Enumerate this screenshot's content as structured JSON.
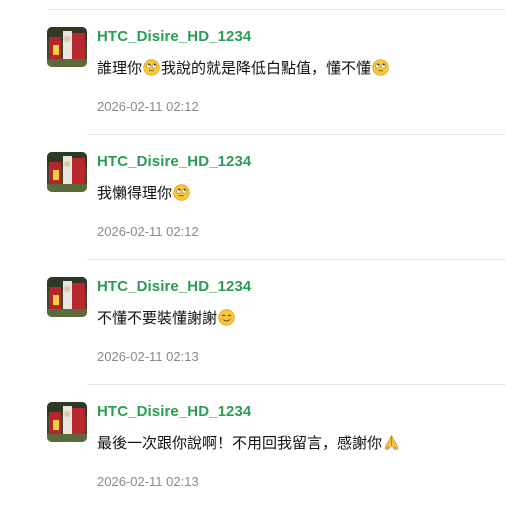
{
  "comments": [
    {
      "username": "HTC_Disire_HD_1234",
      "message_parts": [
        "誰理你",
        "我說的就是降低白點值，懂不懂"
      ],
      "emojis": [
        "rolling-eyes-emoji",
        "rolling-eyes-emoji"
      ],
      "timestamp": "2026-02-11 02:12"
    },
    {
      "username": "HTC_Disire_HD_1234",
      "message_parts": [
        "我懶得理你"
      ],
      "emojis": [
        "rolling-eyes-emoji"
      ],
      "timestamp": "2026-02-11 02:12"
    },
    {
      "username": "HTC_Disire_HD_1234",
      "message_parts": [
        "不懂不要裝懂謝謝"
      ],
      "emojis": [
        "smiling-face-emoji"
      ],
      "timestamp": "2026-02-11 02:13"
    },
    {
      "username": "HTC_Disire_HD_1234",
      "message_parts": [
        "最後一次跟你說啊！不用回我留言，感謝你"
      ],
      "emojis": [
        "folded-hands-emoji"
      ],
      "timestamp": "2026-02-11 02:13"
    }
  ],
  "colors": {
    "username": "#2a9d55",
    "message": "#111111",
    "timestamp": "#8a8a8a",
    "divider": "#e3e3e3"
  }
}
